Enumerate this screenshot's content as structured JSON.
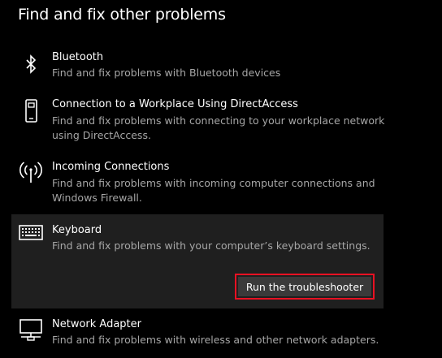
{
  "page": {
    "title": "Find and fix other problems"
  },
  "items": [
    {
      "icon": "bluetooth-icon",
      "title": "Bluetooth",
      "description": "Find and fix problems with Bluetooth devices"
    },
    {
      "icon": "phone-device-icon",
      "title": "Connection to a Workplace Using DirectAccess",
      "description": "Find and fix problems with connecting to your workplace network using DirectAccess."
    },
    {
      "icon": "antenna-icon",
      "title": "Incoming Connections",
      "description": "Find and fix problems with incoming computer connections and Windows Firewall."
    },
    {
      "icon": "keyboard-icon",
      "title": "Keyboard",
      "description": "Find and fix problems with your computer’s keyboard settings.",
      "selected": true,
      "button_label": "Run the troubleshooter"
    },
    {
      "icon": "network-adapter-icon",
      "title": "Network Adapter",
      "description": "Find and fix problems with wireless and other network adapters."
    }
  ],
  "colors": {
    "background": "#000000",
    "selected_background": "#1f1f1f",
    "description_text": "#a6a6a6",
    "highlight_border": "#e81123",
    "button_background": "#3a3a3a"
  }
}
